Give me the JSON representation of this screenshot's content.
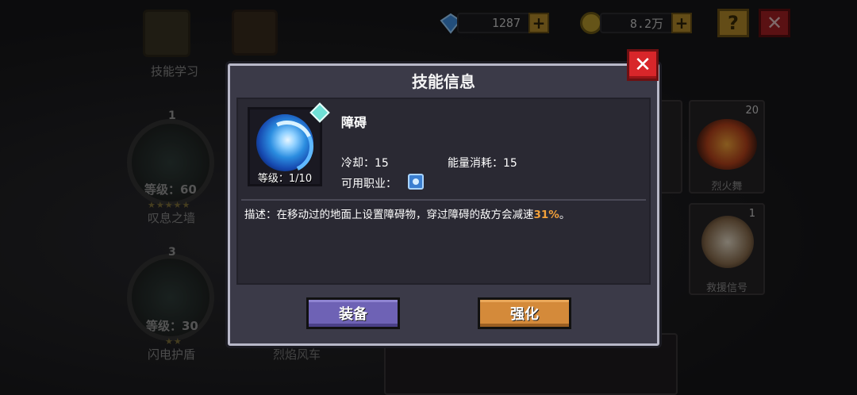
{
  "top_bar": {
    "gems": "1287",
    "coins": "8.2万",
    "help_label": "?",
    "close_label": "✕"
  },
  "background": {
    "skill_learn_label": "技能学习",
    "skills_left": [
      {
        "count": "1",
        "level": "等级：60",
        "name": "叹息之墙"
      },
      {
        "count": "3",
        "level": "等级：30",
        "name": "闪电护盾"
      }
    ],
    "fire_wheel_label": "烈焰风车",
    "right_cards": [
      {
        "count": "20",
        "name": "烈火舞"
      },
      {
        "count": "1",
        "name": "救援信号"
      }
    ]
  },
  "dialog": {
    "title": "技能信息",
    "close_label": "✕",
    "skill_name": "障碍",
    "level_label": "等级：1/10",
    "cooldown": "冷却：15",
    "energy": "能量消耗：15",
    "class_label": "可用职业：",
    "description_prefix": "描述：在移动过的地面上设置障碍物，穿过障碍的敌方会减速",
    "description_highlight": "31%",
    "description_suffix": "。",
    "equip_button": "装备",
    "upgrade_button": "强化"
  },
  "colors": {
    "dialog_bg": "#3b3a48",
    "equip": "#6e62b5",
    "upgrade": "#d48a3a",
    "close": "#d8262a",
    "highlight": "#f2a03a"
  },
  "icons": [
    "gem-icon",
    "coin-icon",
    "help-icon",
    "close-icon",
    "vortex-skill-icon",
    "class-mage-icon"
  ]
}
